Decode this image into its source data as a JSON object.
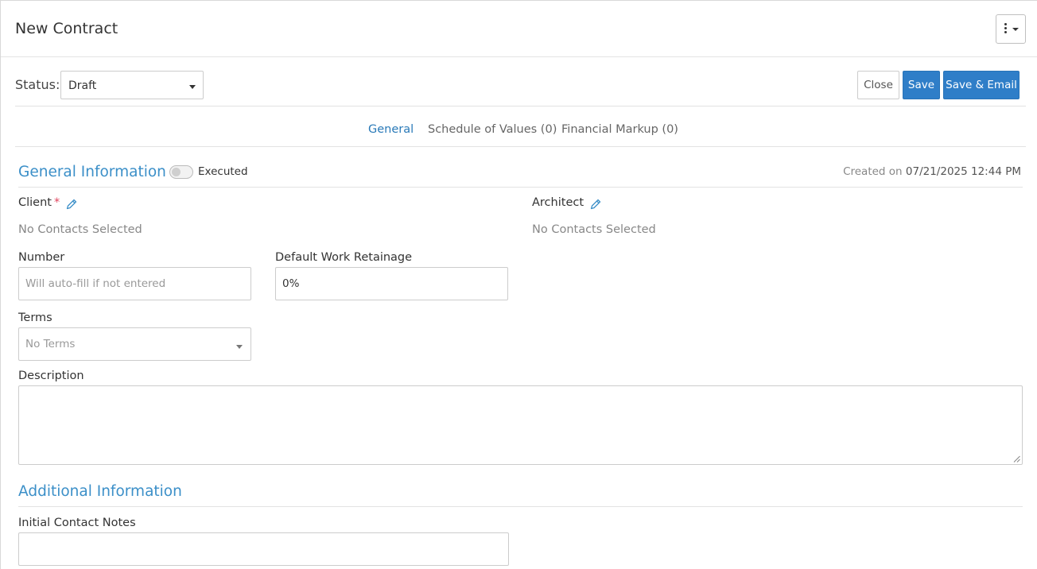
{
  "modal": {
    "title": "New Contract"
  },
  "status": {
    "label": "Status:",
    "selected": "Draft"
  },
  "actions": {
    "close_label": "Close",
    "save_label": "Save",
    "save_email_label": "Save & Email"
  },
  "tabs": [
    {
      "label": "General",
      "active": true
    },
    {
      "label": "Schedule of Values (0)",
      "active": false
    },
    {
      "label": "Financial Markup (0)",
      "active": false
    }
  ],
  "general_info": {
    "title": "General Information",
    "executed_label": "Executed",
    "executed_on": false,
    "created_prefix": "Created on",
    "created_date": "07/21/2025 12:44 PM"
  },
  "client": {
    "label": "Client",
    "required_marker": "*",
    "empty_text": "No Contacts Selected"
  },
  "architect": {
    "label": "Architect",
    "empty_text": "No Contacts Selected"
  },
  "number": {
    "label": "Number",
    "placeholder": "Will auto-fill if not entered"
  },
  "retainage": {
    "label": "Default Work Retainage",
    "value": "0%"
  },
  "terms": {
    "label": "Terms",
    "placeholder": "No Terms"
  },
  "description": {
    "label": "Description",
    "value": ""
  },
  "additional_info": {
    "title": "Additional Information"
  },
  "initial_contact_notes": {
    "label": "Initial Contact Notes",
    "value": ""
  },
  "colors": {
    "accent": "#2f7ec8",
    "heading": "#3b8fc8",
    "required": "#e0455e"
  },
  "icons": [
    "kebab-menu-icon",
    "chevron-down-icon",
    "pencil-icon",
    "resize-grip-icon"
  ]
}
